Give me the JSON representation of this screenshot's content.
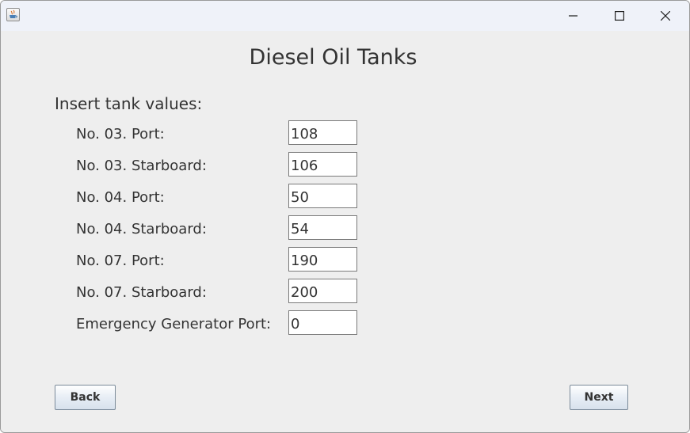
{
  "window": {
    "title_bar": {
      "app_icon": "java-icon",
      "controls": [
        "minimize-icon",
        "maximize-icon",
        "close-icon"
      ]
    }
  },
  "form": {
    "title": "Diesel Oil Tanks",
    "instructions": "Insert tank values:",
    "fields": [
      {
        "label": "No. 03. Port:",
        "value": "108"
      },
      {
        "label": "No. 03. Starboard:",
        "value": "106"
      },
      {
        "label": "No. 04. Port:",
        "value": "50"
      },
      {
        "label": "No. 04. Starboard:",
        "value": "54"
      },
      {
        "label": "No. 07. Port:",
        "value": "190"
      },
      {
        "label": "No. 07. Starboard:",
        "value": "200"
      },
      {
        "label": "Emergency Generator Port:",
        "value": "0"
      }
    ]
  },
  "buttons": {
    "back": "Back",
    "next": "Next"
  }
}
